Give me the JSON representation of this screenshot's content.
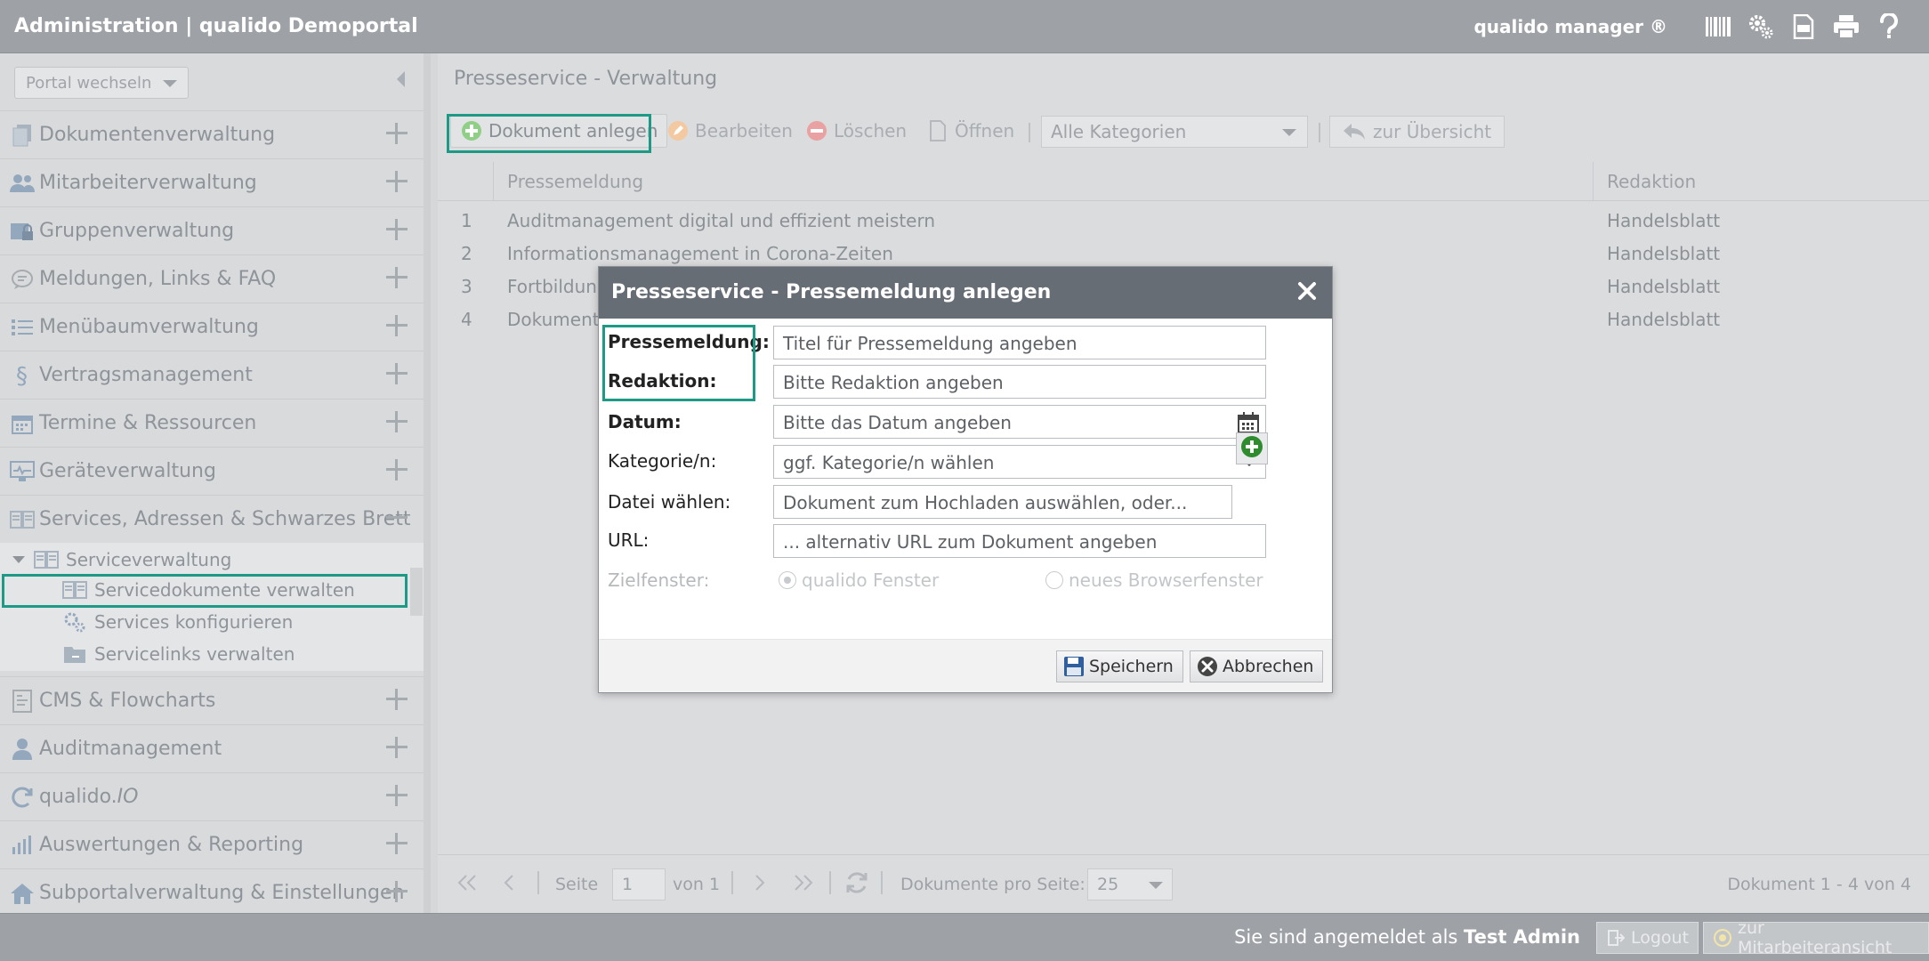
{
  "header": {
    "title": "Administration | qualido Demoportal",
    "brand": "qualido manager ®",
    "icons": [
      "barcode-icon",
      "gears-icon",
      "pdf-icon",
      "printer-icon",
      "help-icon"
    ]
  },
  "sidebar": {
    "portal_select": "Portal wechseln",
    "items": [
      {
        "label": "Dokumentenverwaltung",
        "icon": "documents-icon"
      },
      {
        "label": "Mitarbeiterverwaltung",
        "icon": "users-icon"
      },
      {
        "label": "Gruppenverwaltung",
        "icon": "group-lock-icon"
      },
      {
        "label": "Meldungen, Links & FAQ",
        "icon": "comment-icon"
      },
      {
        "label": "Menübaumverwaltung",
        "icon": "list-icon"
      },
      {
        "label": "Vertragsmanagement",
        "icon": "paragraph-icon"
      },
      {
        "label": "Termine & Ressourcen",
        "icon": "calendar-icon"
      },
      {
        "label": "Geräteverwaltung",
        "icon": "monitor-icon"
      },
      {
        "label": "Services, Adressen & Schwarzes Brett",
        "icon": "book-icon"
      },
      {
        "label": "CMS & Flowcharts",
        "icon": "cms-icon"
      },
      {
        "label": "Auditmanagement",
        "icon": "auditor-icon"
      },
      {
        "label": "qualido.",
        "label_io": "IO",
        "icon": "sync-icon"
      },
      {
        "label": "Auswertungen & Reporting",
        "icon": "bar-chart-icon"
      },
      {
        "label": "Subportalverwaltung & Einstellungen",
        "icon": "home-icon"
      }
    ],
    "subtree": {
      "parent": "Serviceverwaltung",
      "children": [
        "Servicedokumente verwalten",
        "Services konfigurieren",
        "Servicelinks verwalten"
      ]
    }
  },
  "main": {
    "title": "Presseservice - Verwaltung",
    "toolbar": {
      "add": "Dokument anlegen",
      "edit": "Bearbeiten",
      "delete": "Löschen",
      "open": "Öffnen",
      "category": "Alle Kategorien",
      "back": "zur Übersicht"
    },
    "columns": [
      "Pressemeldung",
      "Redaktion"
    ],
    "rows": [
      {
        "n": "1",
        "title": "Auditmanagement digital und effizient meistern",
        "redaktion": "Handelsblatt"
      },
      {
        "n": "2",
        "title": "Informationsmanagement in Corona-Zeiten",
        "redaktion": "Handelsblatt"
      },
      {
        "n": "3",
        "title": "Fortbildung",
        "redaktion": "Handelsblatt"
      },
      {
        "n": "4",
        "title": "Dokument",
        "redaktion": "Handelsblatt"
      }
    ],
    "pager": {
      "page_label": "Seite",
      "page": "1",
      "of": "von 1",
      "per_page_label": "Dokumente pro Seite:",
      "per_page": "25",
      "summary": "Dokument 1 - 4 von 4"
    }
  },
  "modal": {
    "title": "Presseservice - Pressemeldung anlegen",
    "fields": {
      "pressemeldung": {
        "label": "Pressemeldung:",
        "placeholder": "Titel für Pressemeldung  angeben"
      },
      "redaktion": {
        "label": "Redaktion:",
        "placeholder": "Bitte Redaktion angeben"
      },
      "datum": {
        "label": "Datum:",
        "placeholder": "Bitte das Datum angeben"
      },
      "kategorie": {
        "label": "Kategorie/n:",
        "value": "ggf. Kategorie/n wählen"
      },
      "datei": {
        "label": "Datei wählen:",
        "placeholder": "Dokument zum Hochladen auswählen, oder..."
      },
      "url": {
        "label": "URL:",
        "placeholder": "... alternativ URL zum Dokument angeben"
      },
      "zielfenster": {
        "label": "Zielfenster:",
        "option1": "qualido Fenster",
        "option2": "neues Browserfenster"
      }
    },
    "save": "Speichern",
    "cancel": "Abbrechen"
  },
  "footer": {
    "logged_in_prefix": "Sie sind angemeldet als",
    "user": "Test Admin",
    "logout": "Logout",
    "employee_view": "zur Mitarbeiteransicht"
  },
  "colors": {
    "accent": "#1c9a86",
    "modal_header": "#676d75",
    "topbar": "#9ea2a7"
  }
}
